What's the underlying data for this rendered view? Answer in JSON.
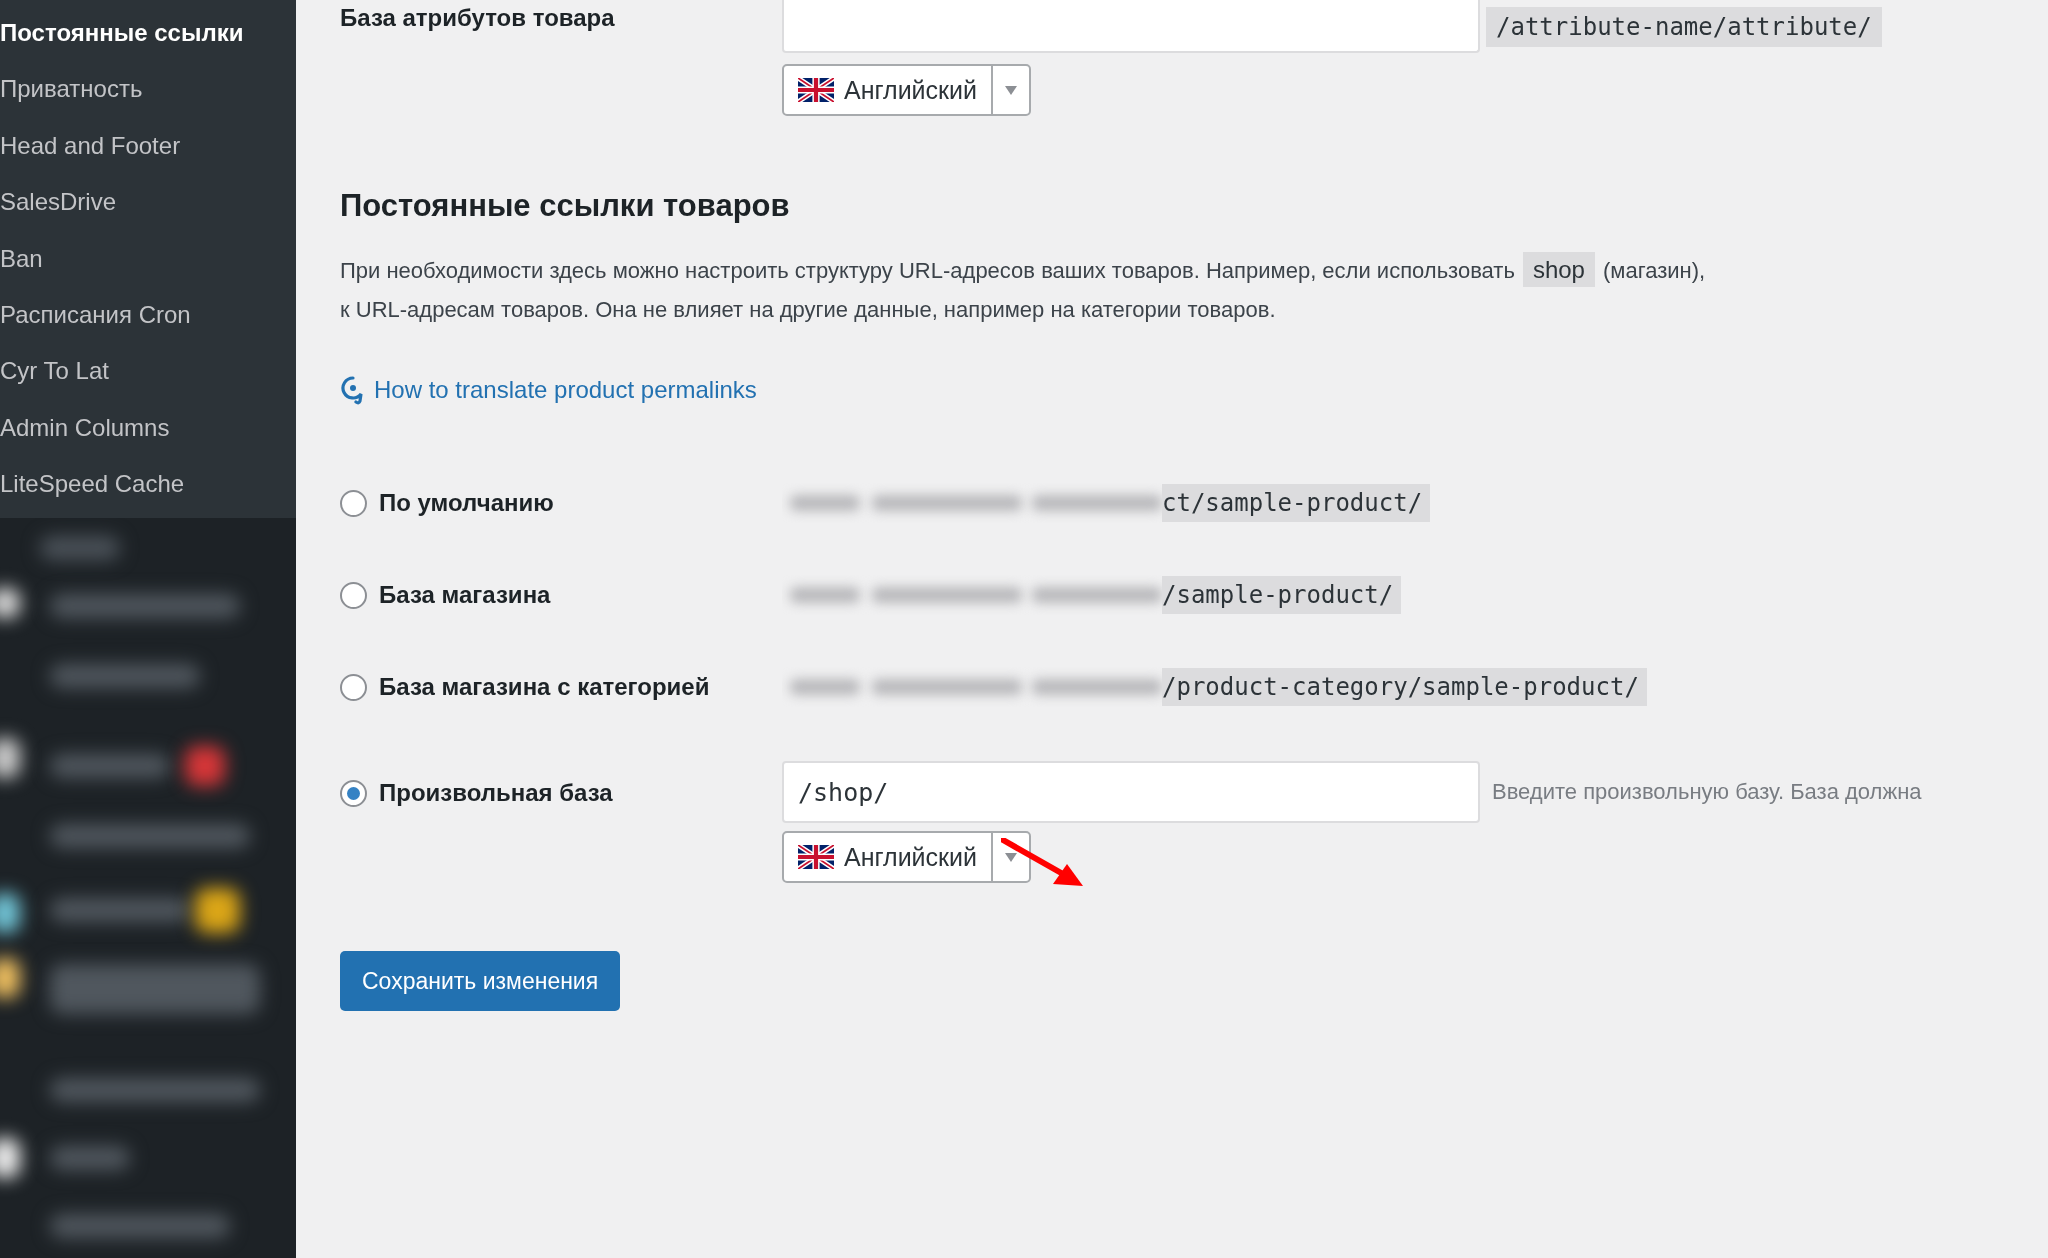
{
  "sidebar": {
    "items": [
      {
        "label": "Постоянные ссылки",
        "selected": true
      },
      {
        "label": "Приватность",
        "selected": false
      },
      {
        "label": "Head and Footer",
        "selected": false
      },
      {
        "label": "SalesDrive",
        "selected": false
      },
      {
        "label": "Ban",
        "selected": false
      },
      {
        "label": "Расписания Cron",
        "selected": false
      },
      {
        "label": "Cyr To Lat",
        "selected": false
      },
      {
        "label": "Admin Columns",
        "selected": false
      },
      {
        "label": "LiteSpeed Cache",
        "selected": false
      }
    ]
  },
  "attribute_base": {
    "label": "База атрибутов товара",
    "example": "/attribute-name/attribute/",
    "language": "Английский"
  },
  "section": {
    "title": "Постоянные ссылки товаров",
    "line_1": {
      "before": "При необходимости здесь можно настроить структуру URL-адресов ваших товаров. Например, если использовать",
      "code": "shop",
      "after": "(магазин),"
    },
    "line_2": "к URL-адресам товаров. Она не влияет на другие данные, например на категории товаров.",
    "help_link": "How to translate product permalinks"
  },
  "options": [
    {
      "kind": "preset",
      "label": "По умолчанию",
      "example": "ct/sample-product/",
      "selected": false
    },
    {
      "kind": "preset",
      "label": "База магазина",
      "example": "/sample-product/",
      "selected": false
    },
    {
      "kind": "preset",
      "label": "База магазина с категорией",
      "example": "/product-category/sample-product/",
      "selected": false
    },
    {
      "kind": "custom",
      "label": "Произвольная база",
      "value": "/shop/",
      "hint": "Введите произвольную базу. База должна",
      "language": "Английский",
      "selected": true
    }
  ],
  "save_button": "Сохранить изменения"
}
